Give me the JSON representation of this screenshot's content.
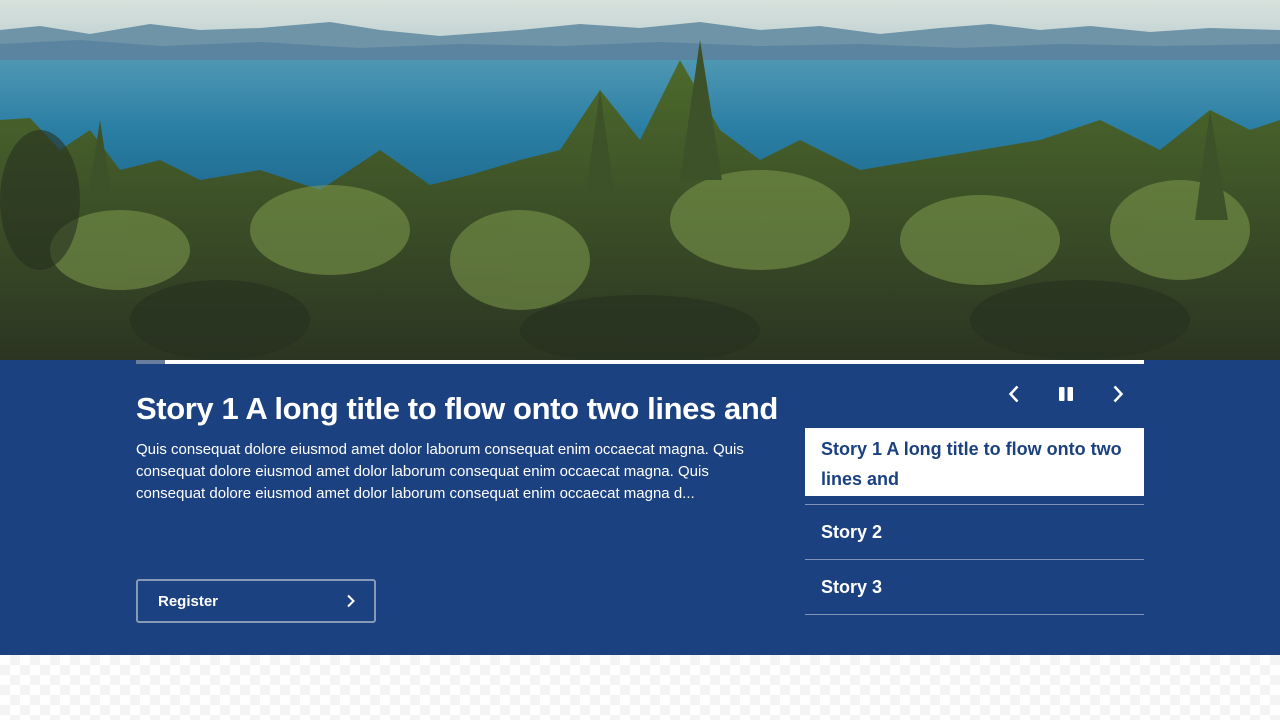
{
  "hero": {
    "image": "landscape-forest-sea",
    "colors": {
      "sky": "#c9d6d3",
      "mountains": "#6d93a9",
      "sea": "#2b7ea3",
      "forest_dark": "#2f3b1f",
      "forest_light": "#6d8a3f"
    }
  },
  "carousel": {
    "progress": 0.029,
    "colors": {
      "band": "#1b4180",
      "progress_track": "#ffffff",
      "progress_fill": "#6b7d9c"
    },
    "active_story": {
      "title": "Story 1 A long title to flow onto two lines and",
      "body": "Quis consequat dolore eiusmod amet dolor laborum consequat enim occaecat magna. Quis consequat dolore eiusmod amet dolor laborum consequat enim occaecat magna. Quis consequat dolore eiusmod amet dolor laborum consequat enim occaecat magna d...",
      "cta_label": "Register",
      "cta_icon": "chevron-right-icon"
    },
    "controls": {
      "prev_icon": "chevron-left-icon",
      "pause_icon": "pause-icon",
      "next_icon": "chevron-right-icon"
    },
    "stories": [
      {
        "label": "Story 1 A long title to flow onto two lines and",
        "active": true
      },
      {
        "label": "Story 2",
        "active": false
      },
      {
        "label": "Story 3",
        "active": false
      }
    ]
  }
}
